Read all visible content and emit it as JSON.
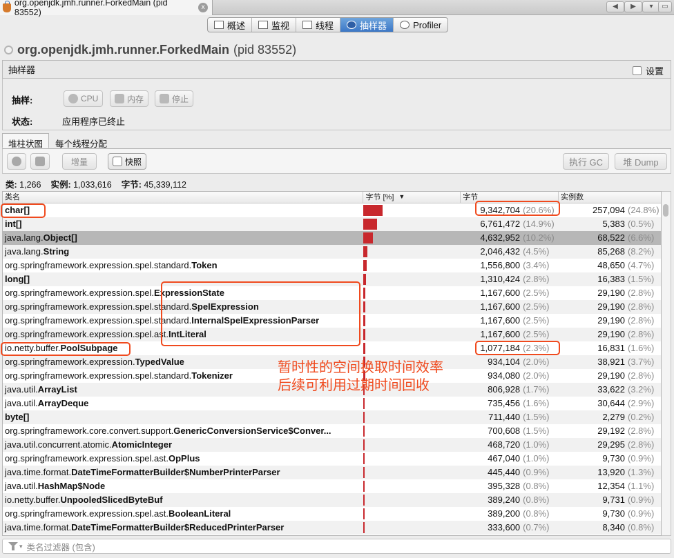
{
  "window": {
    "tab_title": "org.openjdk.jmh.runner.ForkedMain (pid 83552)",
    "close": "x"
  },
  "subtabs": [
    {
      "label": "概述",
      "icon": "overview-icon"
    },
    {
      "label": "监视",
      "icon": "monitor-icon"
    },
    {
      "label": "线程",
      "icon": "threads-icon"
    },
    {
      "label": "抽样器",
      "icon": "sampler-icon",
      "selected": true
    },
    {
      "label": "Profiler",
      "icon": "profiler-icon"
    }
  ],
  "process": {
    "name": "org.openjdk.jmh.runner.ForkedMain",
    "pid": "(pid 83552)"
  },
  "sampler": {
    "header": "抽样器",
    "settings_label": "设置",
    "sample_label": "抽样:",
    "cpu_btn": "CPU",
    "mem_btn": "内存",
    "stop_btn": "停止",
    "status_label": "状态:",
    "status_value": "应用程序已终止"
  },
  "view_tabs": [
    "堆柱状图",
    "每个线程分配"
  ],
  "toolbar": {
    "delta": "增量",
    "snapshot": "快照",
    "gc": "执行 GC",
    "heap_dump": "堆 Dump"
  },
  "stats": {
    "classes_label": "类:",
    "classes": "1,266",
    "instances_label": "实例:",
    "instances": "1,033,616",
    "bytes_label": "字节:",
    "bytes": "45,339,112"
  },
  "table": {
    "columns": [
      "类名",
      "字节 [%]",
      "字节",
      "实例数"
    ],
    "rows": [
      {
        "pre": "",
        "bold": "char[]",
        "bytes": "9,342,704",
        "bpct": "(20.6%)",
        "inst": "257,094",
        "ipct": "(24.8%)",
        "frac": 0.206
      },
      {
        "pre": "",
        "bold": "int[]",
        "bytes": "6,761,472",
        "bpct": "(14.9%)",
        "inst": "5,383",
        "ipct": "(0.5%)",
        "frac": 0.149
      },
      {
        "pre": "java.lang.",
        "bold": "Object[]",
        "bytes": "4,632,952",
        "bpct": "(10.2%)",
        "inst": "68,522",
        "ipct": "(6.6%)",
        "frac": 0.102
      },
      {
        "pre": "java.lang.",
        "bold": "String",
        "bytes": "2,046,432",
        "bpct": "(4.5%)",
        "inst": "85,268",
        "ipct": "(8.2%)",
        "frac": 0.045
      },
      {
        "pre": "org.springframework.expression.spel.standard.",
        "bold": "Token",
        "bytes": "1,556,800",
        "bpct": "(3.4%)",
        "inst": "48,650",
        "ipct": "(4.7%)",
        "frac": 0.034
      },
      {
        "pre": "",
        "bold": "long[]",
        "bytes": "1,310,424",
        "bpct": "(2.8%)",
        "inst": "16,383",
        "ipct": "(1.5%)",
        "frac": 0.028
      },
      {
        "pre": "org.springframework.expression.spel.",
        "bold": "ExpressionState",
        "bytes": "1,167,600",
        "bpct": "(2.5%)",
        "inst": "29,190",
        "ipct": "(2.8%)",
        "frac": 0.025
      },
      {
        "pre": "org.springframework.expression.spel.standard.",
        "bold": "SpelExpression",
        "bytes": "1,167,600",
        "bpct": "(2.5%)",
        "inst": "29,190",
        "ipct": "(2.8%)",
        "frac": 0.025
      },
      {
        "pre": "org.springframework.expression.spel.standard.",
        "bold": "InternalSpelExpressionParser",
        "bytes": "1,167,600",
        "bpct": "(2.5%)",
        "inst": "29,190",
        "ipct": "(2.8%)",
        "frac": 0.025
      },
      {
        "pre": "org.springframework.expression.spel.ast.",
        "bold": "IntLiteral",
        "bytes": "1,167,600",
        "bpct": "(2.5%)",
        "inst": "29,190",
        "ipct": "(2.8%)",
        "frac": 0.025
      },
      {
        "pre": "io.netty.buffer.",
        "bold": "PoolSubpage",
        "bytes": "1,077,184",
        "bpct": "(2.3%)",
        "inst": "16,831",
        "ipct": "(1.6%)",
        "frac": 0.023
      },
      {
        "pre": "org.springframework.expression.",
        "bold": "TypedValue",
        "bytes": "934,104",
        "bpct": "(2.0%)",
        "inst": "38,921",
        "ipct": "(3.7%)",
        "frac": 0.02
      },
      {
        "pre": "org.springframework.expression.spel.standard.",
        "bold": "Tokenizer",
        "bytes": "934,080",
        "bpct": "(2.0%)",
        "inst": "29,190",
        "ipct": "(2.8%)",
        "frac": 0.02
      },
      {
        "pre": "java.util.",
        "bold": "ArrayList",
        "bytes": "806,928",
        "bpct": "(1.7%)",
        "inst": "33,622",
        "ipct": "(3.2%)",
        "frac": 0.017
      },
      {
        "pre": "java.util.",
        "bold": "ArrayDeque",
        "bytes": "735,456",
        "bpct": "(1.6%)",
        "inst": "30,644",
        "ipct": "(2.9%)",
        "frac": 0.016
      },
      {
        "pre": "",
        "bold": "byte[]",
        "bytes": "711,440",
        "bpct": "(1.5%)",
        "inst": "2,279",
        "ipct": "(0.2%)",
        "frac": 0.015
      },
      {
        "pre": "org.springframework.core.convert.support.",
        "bold": "GenericConversionService$Conver...",
        "bytes": "700,608",
        "bpct": "(1.5%)",
        "inst": "29,192",
        "ipct": "(2.8%)",
        "frac": 0.015
      },
      {
        "pre": "java.util.concurrent.atomic.",
        "bold": "AtomicInteger",
        "bytes": "468,720",
        "bpct": "(1.0%)",
        "inst": "29,295",
        "ipct": "(2.8%)",
        "frac": 0.01
      },
      {
        "pre": "org.springframework.expression.spel.ast.",
        "bold": "OpPlus",
        "bytes": "467,040",
        "bpct": "(1.0%)",
        "inst": "9,730",
        "ipct": "(0.9%)",
        "frac": 0.01
      },
      {
        "pre": "java.time.format.",
        "bold": "DateTimeFormatterBuilder$NumberPrinterParser",
        "bytes": "445,440",
        "bpct": "(0.9%)",
        "inst": "13,920",
        "ipct": "(1.3%)",
        "frac": 0.009
      },
      {
        "pre": "java.util.",
        "bold": "HashMap$Node",
        "bytes": "395,328",
        "bpct": "(0.8%)",
        "inst": "12,354",
        "ipct": "(1.1%)",
        "frac": 0.008
      },
      {
        "pre": "io.netty.buffer.",
        "bold": "UnpooledSlicedByteBuf",
        "bytes": "389,240",
        "bpct": "(0.8%)",
        "inst": "9,731",
        "ipct": "(0.9%)",
        "frac": 0.008
      },
      {
        "pre": "org.springframework.expression.spel.ast.",
        "bold": "BooleanLiteral",
        "bytes": "389,200",
        "bpct": "(0.8%)",
        "inst": "9,730",
        "ipct": "(0.9%)",
        "frac": 0.008
      },
      {
        "pre": "java.time.format.",
        "bold": "DateTimeFormatterBuilder$ReducedPrinterParser",
        "bytes": "333,600",
        "bpct": "(0.7%)",
        "inst": "8,340",
        "ipct": "(0.8%)",
        "frac": 0.007
      }
    ],
    "selected_row": 2
  },
  "filter": {
    "placeholder": "类名过滤器 (包含)"
  },
  "annotation": {
    "line1": "暂时性的空间换取时间效率",
    "line2": "后续可利用过期时间回收"
  },
  "colors": {
    "bar": "#c8282d",
    "annotation": "#f04a1e",
    "selected_tab": "#3b77c6"
  }
}
